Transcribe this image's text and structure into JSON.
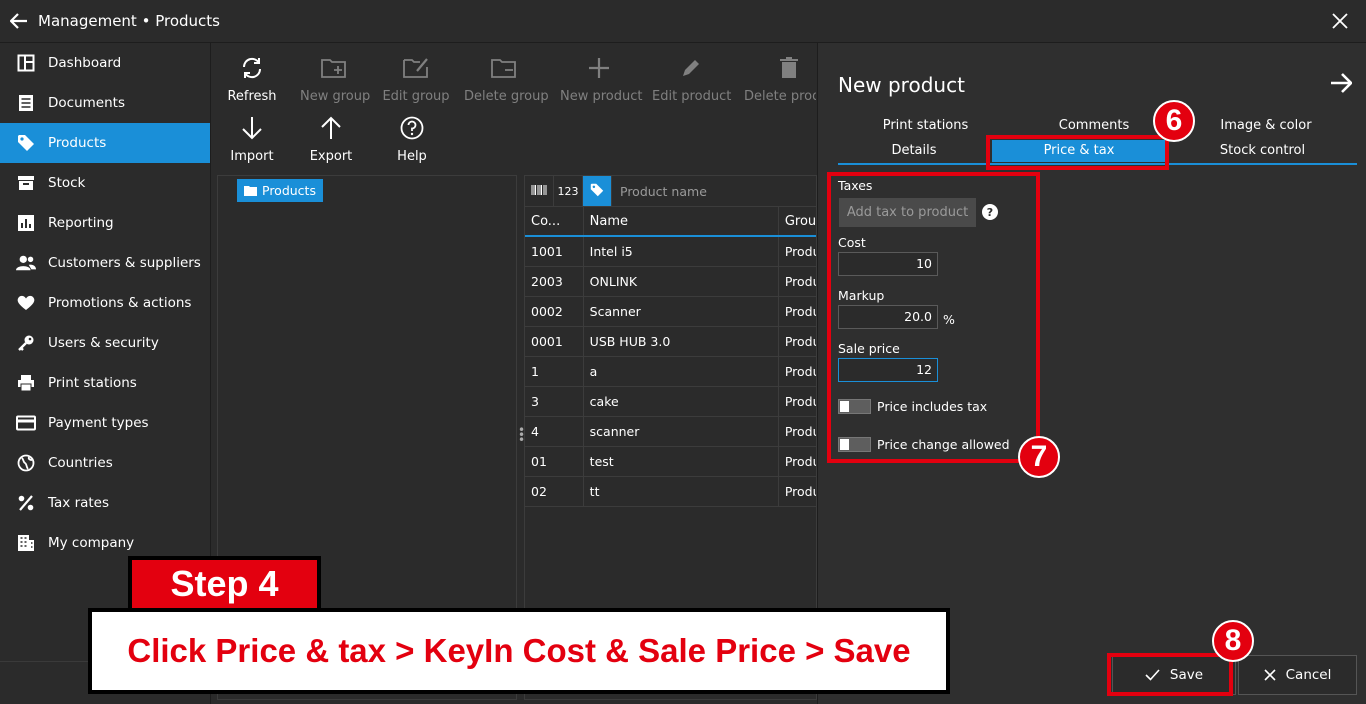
{
  "window": {
    "title": "Management • Products"
  },
  "sidebar": {
    "items": [
      {
        "label": "Dashboard",
        "icon": "dashboard-icon"
      },
      {
        "label": "Documents",
        "icon": "documents-icon"
      },
      {
        "label": "Products",
        "icon": "tag-icon",
        "active": true
      },
      {
        "label": "Stock",
        "icon": "stock-icon"
      },
      {
        "label": "Reporting",
        "icon": "reporting-icon"
      },
      {
        "label": "Customers & suppliers",
        "icon": "people-icon"
      },
      {
        "label": "Promotions & actions",
        "icon": "heart-icon"
      },
      {
        "label": "Users & security",
        "icon": "key-icon"
      },
      {
        "label": "Print stations",
        "icon": "printer-icon"
      },
      {
        "label": "Payment types",
        "icon": "card-icon"
      },
      {
        "label": "Countries",
        "icon": "globe-icon"
      },
      {
        "label": "Tax rates",
        "icon": "percent-icon"
      },
      {
        "label": "My company",
        "icon": "building-icon"
      }
    ]
  },
  "toolbar": {
    "refresh": "Refresh",
    "new_group": "New group",
    "edit_group": "Edit group",
    "delete_group": "Delete group",
    "new_product": "New product",
    "edit_product": "Edit product",
    "delete_product": "Delete product",
    "import": "Import",
    "export": "Export",
    "help": "Help"
  },
  "tree": {
    "root": "Products"
  },
  "grid": {
    "search_code_label": "123",
    "search_placeholder": "Product name",
    "columns": [
      "Co...",
      "Name",
      "Grou"
    ],
    "rows": [
      {
        "code": "1001",
        "name": "Intel i5",
        "group": "Products"
      },
      {
        "code": "2003",
        "name": "ONLINK",
        "group": "Products"
      },
      {
        "code": "0002",
        "name": "Scanner",
        "group": "Products"
      },
      {
        "code": "0001",
        "name": "USB HUB 3.0",
        "group": "Products"
      },
      {
        "code": "1",
        "name": "a",
        "group": "Products"
      },
      {
        "code": "3",
        "name": "cake",
        "group": "Products"
      },
      {
        "code": "4",
        "name": "scanner",
        "group": "Products"
      },
      {
        "code": "01",
        "name": "test",
        "group": "Products"
      },
      {
        "code": "02",
        "name": "tt",
        "group": "Products"
      }
    ]
  },
  "panel": {
    "title": "New product",
    "tabs": {
      "print_stations": "Print stations",
      "comments": "Comments",
      "image_color": "Image & color",
      "details": "Details",
      "price_tax": "Price & tax",
      "stock_control": "Stock control"
    },
    "taxes_label": "Taxes",
    "add_tax": "Add tax to product",
    "help_mark": "?",
    "cost_label": "Cost",
    "cost_value": "10",
    "markup_label": "Markup",
    "markup_value": "20.0",
    "markup_unit": "%",
    "sale_price_label": "Sale price",
    "sale_price_value": "12",
    "price_includes_tax": "Price includes tax",
    "price_change_allowed": "Price change allowed",
    "save": "Save",
    "cancel": "Cancel"
  },
  "annotations": {
    "badge_6": "6",
    "badge_7": "7",
    "badge_8": "8",
    "step": "Step 4",
    "instruction": "Click Price & tax > KeyIn Cost & Sale Price > Save",
    "accent_color": "#e3000f"
  },
  "colors": {
    "accent": "#1a8fd8",
    "background": "#2b2b2b"
  }
}
